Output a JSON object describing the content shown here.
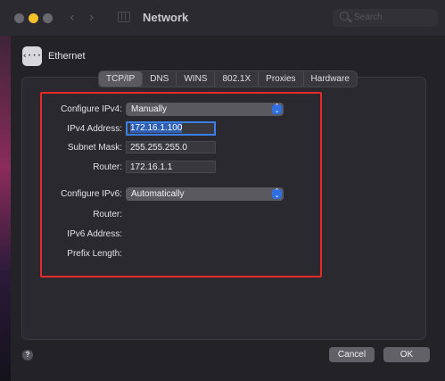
{
  "window": {
    "title": "Network"
  },
  "search": {
    "placeholder": "Search"
  },
  "interface": {
    "name": "Ethernet",
    "icon": "ethernet-icon",
    "icon_glyph": "‹···›"
  },
  "tabs": [
    "TCP/IP",
    "DNS",
    "WINS",
    "802.1X",
    "Proxies",
    "Hardware"
  ],
  "active_tab": "TCP/IP",
  "ipv4": {
    "configure_label": "Configure IPv4:",
    "configure_value": "Manually",
    "address_label": "IPv4 Address:",
    "address_value": "172.16.1.100",
    "subnet_label": "Subnet Mask:",
    "subnet_value": "255.255.255.0",
    "router_label": "Router:",
    "router_value": "172.16.1.1"
  },
  "ipv6": {
    "configure_label": "Configure IPv6:",
    "configure_value": "Automatically",
    "router_label": "Router:",
    "address_label": "IPv6 Address:",
    "prefix_label": "Prefix Length:"
  },
  "footer": {
    "help": "?",
    "cancel": "Cancel",
    "ok": "OK"
  },
  "colors": {
    "highlight": "#e62a2a",
    "accent": "#2f6fe0",
    "focus_ring": "#3a7fe8"
  }
}
